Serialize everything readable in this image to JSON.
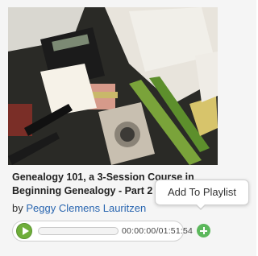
{
  "course": {
    "title": "Genealogy 101, a 3-Session Course in Beginning Genealogy - Part 2",
    "by_prefix": "by",
    "author": "Peggy Clemens Lauritzen",
    "thumbnail_alt": "Photo of a desk cluttered with a calculator, camera, notes and papers"
  },
  "player": {
    "elapsed_time": "00:00:00",
    "total_time": "01:51:54",
    "progress_fraction": 0,
    "play_icon": "play-icon"
  },
  "actions": {
    "add_icon": "plus-circle-icon",
    "tooltip": "Add To Playlist",
    "accent_color": "#5cb85c",
    "play_color": "#6fae3a",
    "link_color": "#2a66b0"
  }
}
